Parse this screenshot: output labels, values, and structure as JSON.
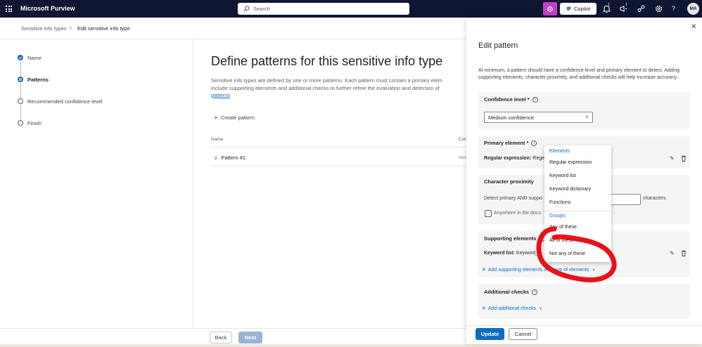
{
  "topbar": {
    "app_title": "Microsoft Purview",
    "search_placeholder": "Search",
    "copilot_label": "Copilot",
    "notif_count_1": "1",
    "notif_count_2": "1",
    "help_glyph": "?",
    "avatar_initials": "MA"
  },
  "breadcrumb": {
    "item1": "Sensitive info types",
    "separator": ">",
    "current": "Edit sensitive info type"
  },
  "wizard": {
    "steps": [
      {
        "label": "Name",
        "state": "completed"
      },
      {
        "label": "Patterns",
        "state": "current"
      },
      {
        "label": "Recommended confidence level",
        "state": "pending"
      },
      {
        "label": "Finish",
        "state": "pending"
      }
    ]
  },
  "main": {
    "title": "Define patterns for this sensitive info type",
    "desc_line1": "Sensitive info types are defined by one or more patterns. Each pattern must contain a primary elem",
    "desc_line2": "include supporting elements and additional checks to further refine the evaluation and detection of",
    "desc_link": "patterns",
    "create_label": "Create pattern",
    "col_name": "Name",
    "col_confidence": "Con",
    "pattern_name": "Pattern #1",
    "pattern_conf": "Med",
    "back_label": "Back",
    "next_label": "Next"
  },
  "panel": {
    "close_glyph": "✕",
    "title": "Edit pattern",
    "description": "At minimum, a pattern should have a confidence level and primary element to detect. Adding supporting elements, character proximity, and additional checks will help increase accuracy.",
    "confidence_title": "Confidence level *",
    "confidence_value": "Medium confidence",
    "primary_title": "Primary element *",
    "primary_key": "Regular expression:",
    "primary_value": " Regex_",
    "proximity_title": "Character proximity",
    "proximity_text": "Detect primary AND suppo",
    "proximity_unit": "characters",
    "anywhere_label": "Anywhere in the docu",
    "supporting_title": "Supporting elements",
    "supporting_key": "Keyword list:",
    "supporting_value": " Keyword_",
    "add_supporting": "Add supporting elements or group of elements",
    "additional_title": "Additional checks",
    "add_additional": "Add additional checks",
    "update_label": "Update",
    "cancel_label": "Cancel"
  },
  "dropdown_menu": {
    "elements_header": "Elements",
    "elements": [
      "Regular expression",
      "Keyword list",
      "Keyword dictionary",
      "Functions"
    ],
    "groups_header": "Groups",
    "groups": [
      "Any of these",
      "All of these",
      "Not any of these"
    ]
  },
  "colors": {
    "topbar": "#0f1632",
    "accent": "#0f6cbd",
    "copilot_button": "#c13fc9",
    "annotation": "#e8111a"
  }
}
